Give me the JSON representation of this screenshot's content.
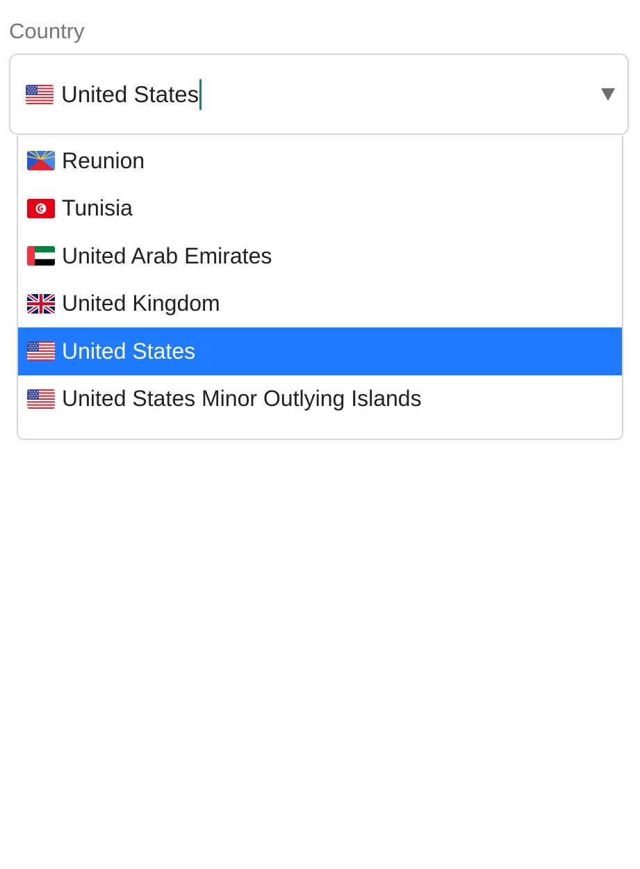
{
  "field": {
    "label": "Country",
    "value": "United States",
    "value_flag": "us-flag-icon"
  },
  "dropdown": {
    "arrow_icon": "triangle-down-icon",
    "options": [
      {
        "label": "Reunion",
        "flag": "reunion-flag-icon",
        "selected": false
      },
      {
        "label": "Tunisia",
        "flag": "tunisia-flag-icon",
        "selected": false
      },
      {
        "label": "United Arab Emirates",
        "flag": "uae-flag-icon",
        "selected": false
      },
      {
        "label": "United Kingdom",
        "flag": "uk-flag-icon",
        "selected": false
      },
      {
        "label": "United States",
        "flag": "us-flag-icon",
        "selected": true
      },
      {
        "label": "United States Minor Outlying Islands",
        "flag": "us-flag-icon",
        "selected": false
      }
    ]
  },
  "colors": {
    "selected_background": "#1e7bff",
    "caret": "#1a7f72",
    "label_text": "#757575",
    "border": "#d6d6d6"
  }
}
